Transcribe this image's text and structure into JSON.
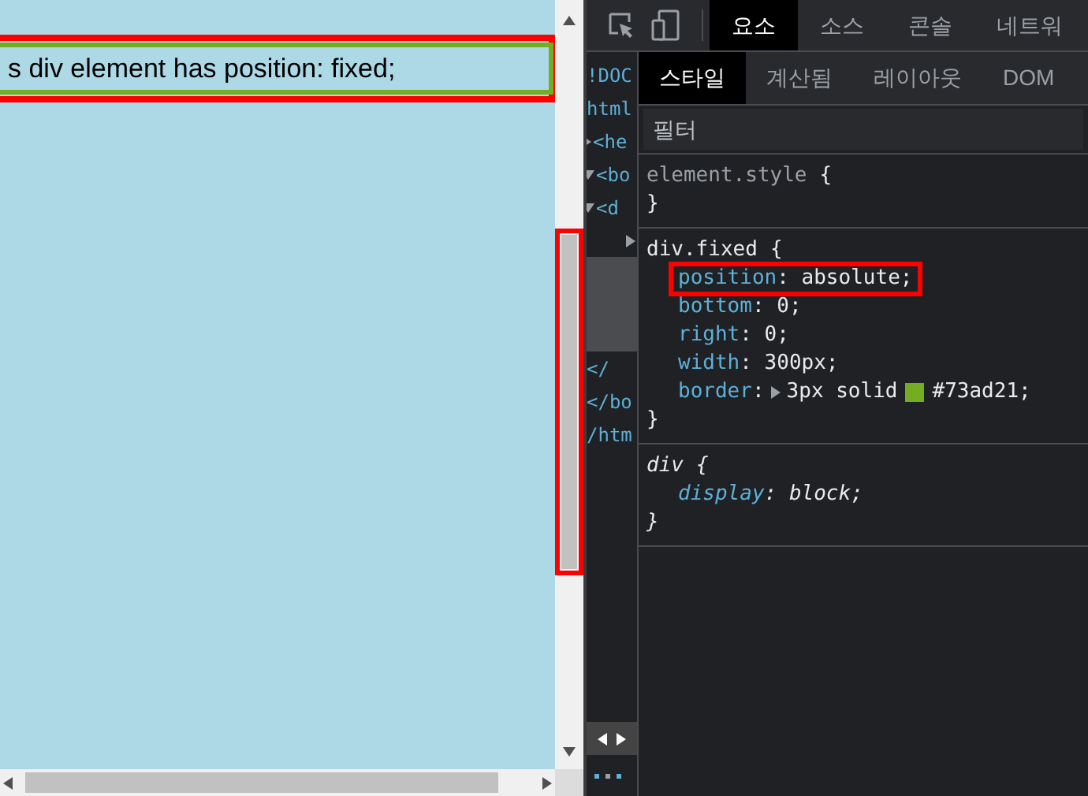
{
  "page": {
    "fixed_text": "s div element has position: fixed;",
    "annotated": true
  },
  "scrollbar": {
    "annotated": true
  },
  "devtools": {
    "tabs": [
      {
        "label": "요소",
        "selected": true
      },
      {
        "label": "소스",
        "selected": false
      },
      {
        "label": "콘솔",
        "selected": false
      },
      {
        "label": "네트워",
        "selected": false
      }
    ],
    "dom_lines": [
      {
        "text": "!DOC",
        "selected": false
      },
      {
        "text": "html",
        "selected": false
      },
      {
        "text": "<he",
        "expanded": false,
        "selected": false
      },
      {
        "text": "<bo",
        "expanded": true,
        "selected": false
      },
      {
        "text": "<d",
        "expanded": true,
        "selected": false
      },
      {
        "expanded": false,
        "selected": false
      },
      {
        "selected": true
      },
      {
        "text": "</",
        "selected": false
      },
      {
        "text": "</bo",
        "selected": false
      },
      {
        "text": "/htm",
        "selected": false
      }
    ],
    "subtabs": [
      {
        "label": "스타일",
        "selected": true
      },
      {
        "label": "계산됨",
        "selected": false
      },
      {
        "label": "레이아웃",
        "selected": false
      },
      {
        "label": "DOM",
        "selected": false
      }
    ],
    "filter": {
      "placeholder": "필터"
    },
    "rules": [
      {
        "selector": "element.style",
        "open": "{",
        "close": "}",
        "kind": "inline"
      },
      {
        "selector": "div.fixed",
        "open": "{",
        "close": "}",
        "kind": "author",
        "declarations": [
          {
            "property": "position",
            "colon": ":",
            "value": "absolute;",
            "annotated": true
          },
          {
            "property": "bottom",
            "colon": ":",
            "value": "0;",
            "annotated": false
          },
          {
            "property": "right",
            "colon": ":",
            "value": "0;",
            "annotated": false
          },
          {
            "property": "width",
            "colon": ":",
            "value": "300px;",
            "annotated": false
          },
          {
            "property": "border",
            "colon": ":",
            "value": "3px solid",
            "color": "#73ad21",
            "color_text": "#73ad21;",
            "annotated": false
          }
        ]
      },
      {
        "selector": "div",
        "open": "{",
        "close": "}",
        "kind": "user_agent",
        "declarations": [
          {
            "property": "display",
            "colon": ":",
            "value": "block;",
            "annotated": false
          }
        ]
      }
    ]
  }
}
